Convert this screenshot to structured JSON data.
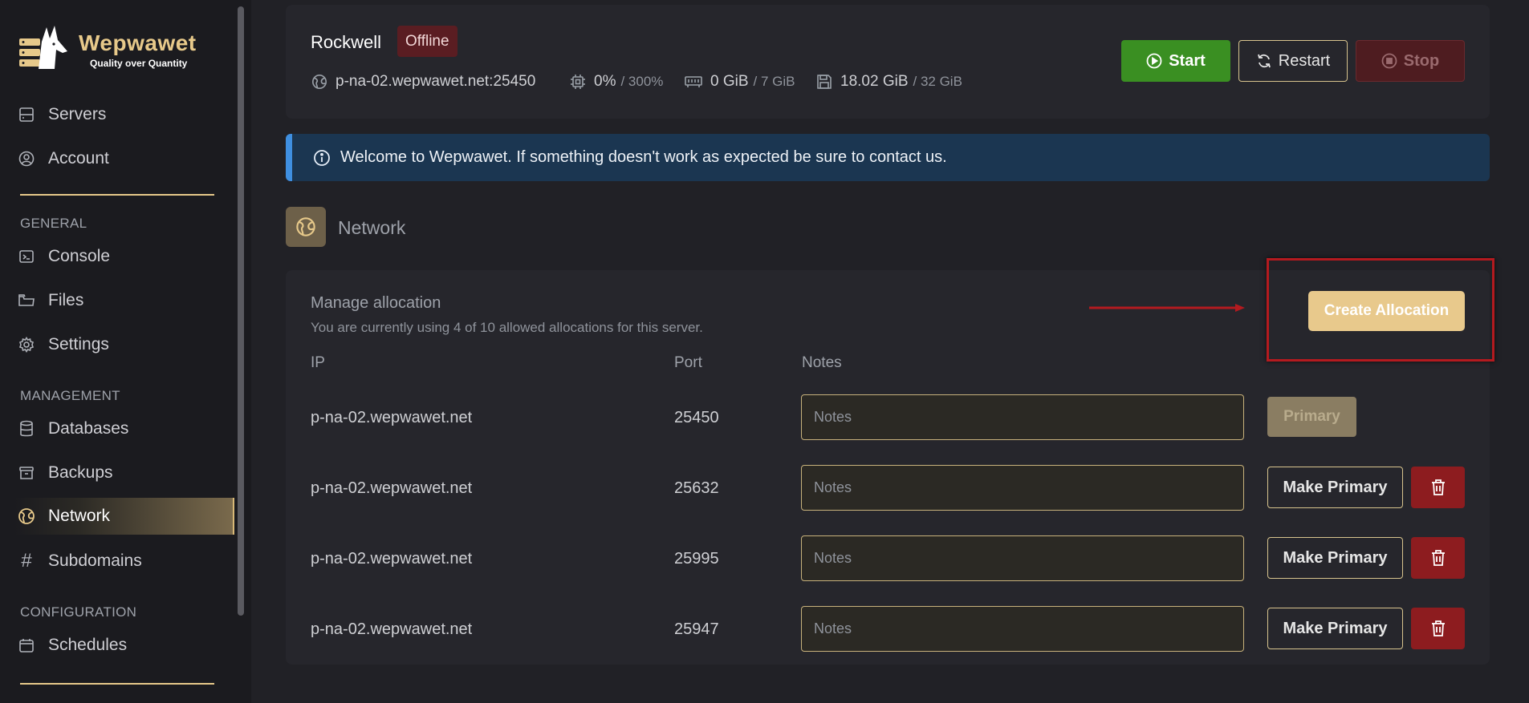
{
  "brand": {
    "name": "Wepwawet",
    "tagline": "Quality over Quantity"
  },
  "sidebar": {
    "top_items": [
      {
        "label": "Servers",
        "icon": "server-icon"
      },
      {
        "label": "Account",
        "icon": "user-circle-icon"
      }
    ],
    "sections": [
      {
        "title": "GENERAL",
        "items": [
          {
            "label": "Console",
            "icon": "terminal-icon"
          },
          {
            "label": "Files",
            "icon": "folder-icon"
          },
          {
            "label": "Settings",
            "icon": "gear-icon"
          }
        ]
      },
      {
        "title": "MANAGEMENT",
        "items": [
          {
            "label": "Databases",
            "icon": "database-icon"
          },
          {
            "label": "Backups",
            "icon": "archive-icon"
          },
          {
            "label": "Network",
            "icon": "globe-icon",
            "active": true
          },
          {
            "label": "Subdomains",
            "icon": "hash-icon"
          }
        ]
      },
      {
        "title": "CONFIGURATION",
        "items": [
          {
            "label": "Schedules",
            "icon": "calendar-icon"
          }
        ]
      }
    ]
  },
  "server": {
    "name": "Rockwell",
    "status": "Offline",
    "address": "p-na-02.wepwawet.net:25450",
    "cpu": {
      "used": "0%",
      "limit": "/ 300%"
    },
    "memory": {
      "used": "0 GiB",
      "limit": "/ 7 GiB"
    },
    "disk": {
      "used": "18.02 GiB",
      "limit": "/ 32 GiB"
    }
  },
  "power": {
    "start": "Start",
    "restart": "Restart",
    "stop": "Stop"
  },
  "alert": {
    "text": "Welcome to Wepwawet. If something doesn't work as expected be sure to contact us."
  },
  "network": {
    "title": "Network",
    "manage_title": "Manage allocation",
    "manage_sub": "You are currently using 4 of 10 allowed allocations for this server.",
    "create_label": "Create Allocation",
    "columns": {
      "ip": "IP",
      "port": "Port",
      "notes": "Notes"
    },
    "notes_placeholder": "Notes",
    "primary_label": "Primary",
    "make_primary_label": "Make Primary",
    "allocations": [
      {
        "ip": "p-na-02.wepwawet.net",
        "port": "25450",
        "primary": true
      },
      {
        "ip": "p-na-02.wepwawet.net",
        "port": "25632",
        "primary": false
      },
      {
        "ip": "p-na-02.wepwawet.net",
        "port": "25995",
        "primary": false
      },
      {
        "ip": "p-na-02.wepwawet.net",
        "port": "25947",
        "primary": false
      }
    ]
  },
  "colors": {
    "accent": "#e7c98a",
    "start": "#3a8f22",
    "danger": "#8d1c1f",
    "alert_bg": "#1b3651",
    "annotation": "#b41a1f"
  }
}
